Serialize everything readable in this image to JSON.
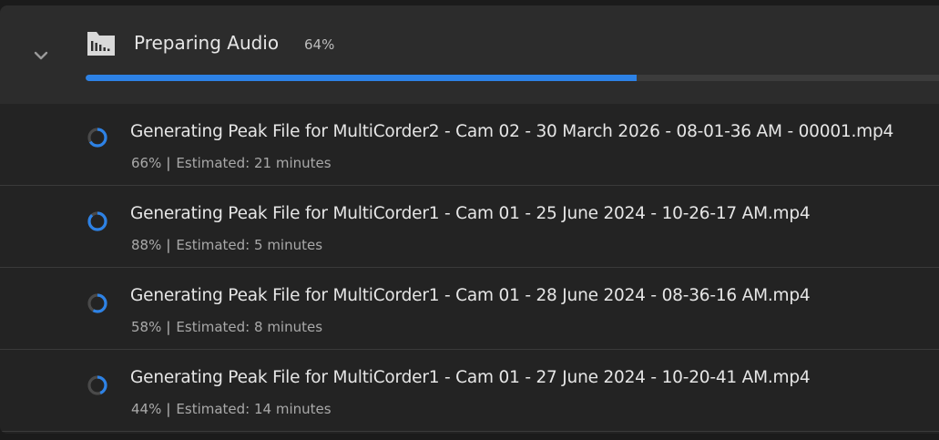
{
  "header": {
    "title": "Preparing Audio",
    "percent_label": "64%",
    "progress": 0.64,
    "icon": "audio-folder-icon",
    "collapse_icon": "chevron-down-icon"
  },
  "tasks": [
    {
      "title": "Generating Peak File for MultiCorder2 - Cam 02 - 30 March 2026 - 08-01-36 AM - 00001.mp4",
      "percent_label": "66%",
      "separator": "|",
      "estimate": "Estimated: 21 minutes",
      "progress": 0.66
    },
    {
      "title": "Generating Peak File for MultiCorder1 - Cam 01 - 25 June 2024 - 10-26-17 AM.mp4",
      "percent_label": "88%",
      "separator": "|",
      "estimate": "Estimated: 5 minutes",
      "progress": 0.88
    },
    {
      "title": "Generating Peak File for MultiCorder1 - Cam 01 - 28 June 2024 - 08-36-16 AM.mp4",
      "percent_label": "58%",
      "separator": "|",
      "estimate": "Estimated: 8 minutes",
      "progress": 0.58
    },
    {
      "title": "Generating Peak File for MultiCorder1 - Cam 01 - 27 June 2024 - 10-20-41 AM.mp4",
      "percent_label": "44%",
      "separator": "|",
      "estimate": "Estimated: 14 minutes",
      "progress": 0.44
    }
  ],
  "colors": {
    "accent": "#2d82e6",
    "track": "#3c3c3c",
    "header_bg": "#2c2c2c",
    "row_bg": "#232323",
    "spinner_track": "#4a4a4a"
  }
}
